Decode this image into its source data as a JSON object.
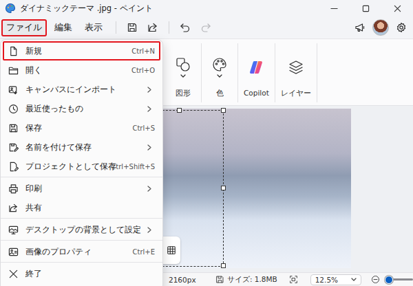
{
  "window": {
    "title": "ダイナミックテーマ .jpg - ペイント"
  },
  "menubar": {
    "items": [
      {
        "label": "ファイル",
        "selected": true
      },
      {
        "label": "編集",
        "selected": false
      },
      {
        "label": "表示",
        "selected": false
      }
    ]
  },
  "toolbar": {
    "undo": {
      "disabled": false
    },
    "redo": {
      "disabled": true
    }
  },
  "ribbon": {
    "groups": [
      {
        "label": "図形"
      },
      {
        "label": "色"
      },
      {
        "label": "Copilot"
      },
      {
        "label": "レイヤー"
      }
    ]
  },
  "file_menu": {
    "items": [
      {
        "kind": "item",
        "label": "新規",
        "shortcut": "Ctrl+N",
        "submenu": false,
        "highlighted": true
      },
      {
        "kind": "item",
        "label": "開く",
        "shortcut": "Ctrl+O",
        "submenu": false,
        "highlighted": false
      },
      {
        "kind": "item",
        "label": "キャンバスにインポート",
        "submenu": true,
        "highlighted": false
      },
      {
        "kind": "item",
        "label": "最近使ったもの",
        "submenu": true,
        "highlighted": false
      },
      {
        "kind": "item",
        "label": "保存",
        "shortcut": "Ctrl+S",
        "submenu": false,
        "highlighted": false
      },
      {
        "kind": "item",
        "label": "名前を付けて保存",
        "submenu": true,
        "highlighted": false
      },
      {
        "kind": "item",
        "label": "プロジェクトとして保存",
        "shortcut": "Ctrl+Shift+S",
        "submenu": false,
        "highlighted": false
      },
      {
        "kind": "separator"
      },
      {
        "kind": "item",
        "label": "印刷",
        "submenu": true,
        "highlighted": false
      },
      {
        "kind": "item",
        "label": "共有",
        "submenu": false,
        "highlighted": false
      },
      {
        "kind": "separator"
      },
      {
        "kind": "item",
        "label": "デスクトップの背景として設定",
        "submenu": true,
        "highlighted": false
      },
      {
        "kind": "separator"
      },
      {
        "kind": "item",
        "label": "画像のプロパティ",
        "shortcut": "Ctrl+E",
        "submenu": false,
        "highlighted": false
      },
      {
        "kind": "separator"
      },
      {
        "kind": "item",
        "label": "終了",
        "submenu": false,
        "highlighted": false
      }
    ]
  },
  "status_bar": {
    "dimensions": "2160px",
    "size": "サイズ: 1.8MB",
    "zoom": "12.5%",
    "zoom_level": 0.1
  }
}
